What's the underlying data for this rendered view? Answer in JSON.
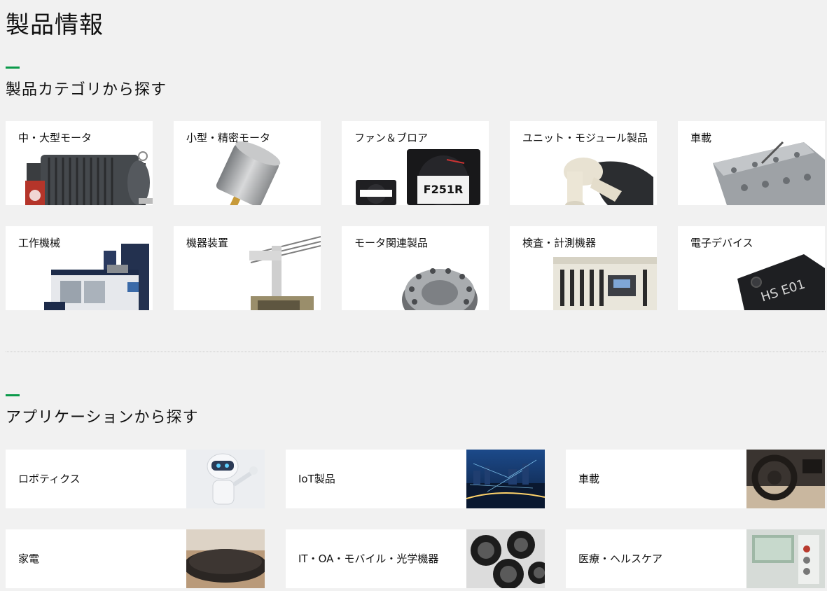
{
  "page": {
    "title": "製品情報"
  },
  "categories": {
    "heading": "製品カテゴリから探す",
    "items": [
      {
        "label": "中・大型モータ"
      },
      {
        "label": "小型・精密モータ"
      },
      {
        "label": "ファン＆ブロア"
      },
      {
        "label": "ユニット・モジュール製品"
      },
      {
        "label": "車載"
      },
      {
        "label": "工作機械"
      },
      {
        "label": "機器装置"
      },
      {
        "label": "モータ関連製品"
      },
      {
        "label": "検査・計測機器"
      },
      {
        "label": "電子デバイス"
      }
    ],
    "fan_text": "F251R",
    "chip_text": "HS E01"
  },
  "applications": {
    "heading": "アプリケーションから探す",
    "items": [
      {
        "label": "ロボティクス"
      },
      {
        "label": "IoT製品"
      },
      {
        "label": "車載"
      },
      {
        "label": "家電"
      },
      {
        "label": "IT・OA・モバイル・光学機器"
      },
      {
        "label": "医療・ヘルスケア"
      }
    ]
  },
  "colors": {
    "accent": "#0b9a4a",
    "background": "#f1f1f1",
    "card": "#ffffff"
  }
}
